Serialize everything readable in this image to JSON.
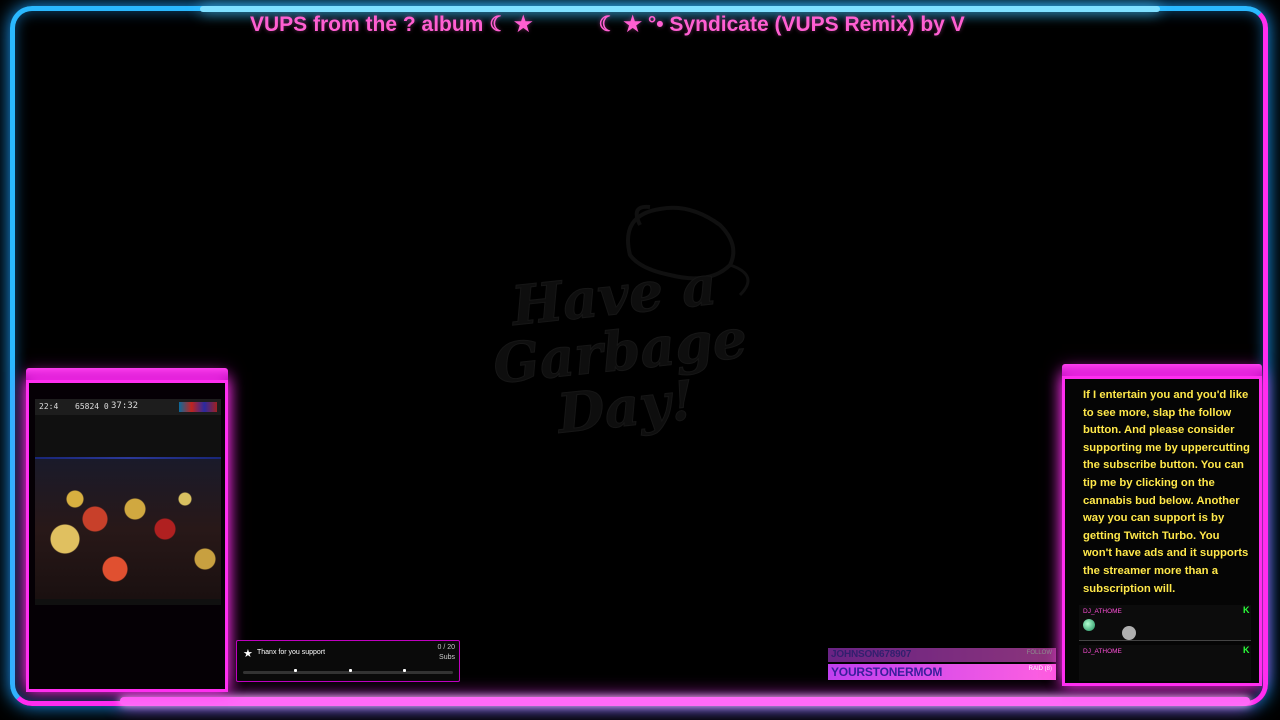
{
  "ticker": {
    "segment1": "VUPS from the ? album ☾ ★",
    "segment2": "☾ ★ °• Syndicate (VUPS Remix) by V"
  },
  "background_logo": {
    "line1": "Have a",
    "line2": "Garbage",
    "line3": "Day!"
  },
  "game_capture": {
    "timer": "37:32",
    "hud_left": "22:4",
    "hud_stats": "65824 0"
  },
  "sub_goal": {
    "title": "Thanx for you support",
    "count": "0 / 20",
    "unit": "Subs",
    "progress": 0
  },
  "alerts": [
    {
      "name": "JOHNSON678907",
      "tag": "FOLLOW"
    },
    {
      "name": "YOURSTONERMOM",
      "tag": "RAID (8)"
    }
  ],
  "chat": {
    "message": "If I entertain you and you'd like to see more, slap the follow button. And please consider supporting me by uppercutting the subscribe button. You can tip me by clicking on the cannabis bud below. Another way you can support is by getting Twitch Turbo. You won't have ads and it supports the streamer more than a subscription will.",
    "entries": [
      {
        "user": "DJ_ATHOME"
      },
      {
        "user": "DJ_ATHOME"
      }
    ]
  },
  "colors": {
    "frame_blue": "#2ab8ff",
    "frame_pink": "#ff2ef0",
    "ticker_text": "#ff5fd2",
    "chat_text": "#ffe84a",
    "alert_bg": "#ff60e0"
  }
}
